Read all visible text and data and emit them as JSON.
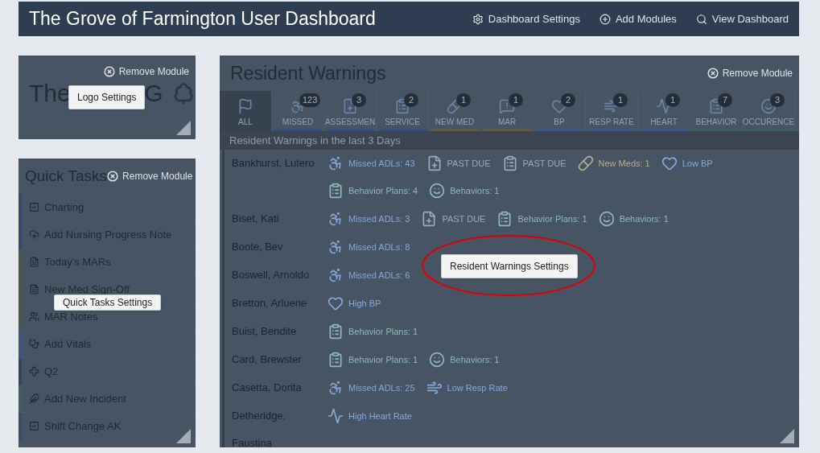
{
  "header": {
    "title": "The Grove of Farmington User Dashboard",
    "nav": [
      {
        "kind": "settings",
        "label": "Dashboard Settings"
      },
      {
        "kind": "add",
        "label": "Add Modules"
      },
      {
        "kind": "search",
        "label": "View Dashboard"
      }
    ]
  },
  "logo_module": {
    "remove": "Remove Module",
    "logo_text_left": "The",
    "logo_text_right": "G",
    "settings_button": "Logo Settings"
  },
  "quick_tasks": {
    "title": "Quick Tasks",
    "remove": "Remove Module",
    "settings_button": "Quick Tasks Settings",
    "items": [
      {
        "kind": "check",
        "label": "Charting",
        "color": "#34496a"
      },
      {
        "kind": "upload",
        "label": "Add Nursing Progress Note",
        "color": "#34496a"
      },
      {
        "kind": "rx",
        "label": "Today's MARs",
        "color": "#4b5550"
      },
      {
        "kind": "rx",
        "label": "New Med Sign-Off",
        "color": "#4b5550"
      },
      {
        "kind": "notes",
        "label": "MAR Notes",
        "color": "#4b5550"
      },
      {
        "kind": "vitals",
        "label": "Add Vitals",
        "color": "#3b5678"
      },
      {
        "kind": "cross",
        "label": "Q2",
        "color": "#36455e"
      },
      {
        "kind": "incident",
        "label": "Add New Incident",
        "color": "#3e5f5e"
      },
      {
        "kind": "check",
        "label": "Shift Change AK",
        "color": "#41476b"
      }
    ]
  },
  "resident_warnings": {
    "title": "Resident Warnings",
    "remove": "Remove Module",
    "settings_button": "Resident Warnings Settings",
    "section_title": "Resident Warnings in the last 3 Days",
    "tabs": [
      {
        "kind": "all",
        "label": "ALL",
        "selected": true
      },
      {
        "kind": "missed",
        "label": "MISSED",
        "badge": "123",
        "selected": false,
        "color": "#3b4f7a"
      },
      {
        "kind": "assessment",
        "label": "ASSESSMEN",
        "badge": "3",
        "selected": false,
        "color": "#3b4f7a"
      },
      {
        "kind": "service",
        "label": "SERVICE",
        "badge": "2",
        "selected": false,
        "color": "#3b4f7a"
      },
      {
        "kind": "meds",
        "label": "NEW MED",
        "badge": "1",
        "selected": false,
        "color": "#5c5a48"
      },
      {
        "kind": "mar",
        "label": "MAR",
        "badge": "1",
        "selected": false,
        "color": "#5c5a48"
      },
      {
        "kind": "bp",
        "label": "BP",
        "badge": "2",
        "selected": false,
        "color": "#3a5a82"
      },
      {
        "kind": "resp",
        "label": "RESP RATE",
        "badge": "1",
        "selected": false,
        "color": "#3a5a82"
      },
      {
        "kind": "heart",
        "label": "HEART",
        "badge": "1",
        "selected": false,
        "color": "#3a5a82"
      },
      {
        "kind": "behavior",
        "label": "BEHAVIOR",
        "badge": "7",
        "selected": false,
        "color": "#3d5e5a"
      },
      {
        "kind": "occurence",
        "label": "OCCURENCE",
        "badge": "3",
        "selected": false,
        "color": "#3d5e5a"
      }
    ],
    "residents": [
      {
        "name": "Bankhurst, Lutero",
        "warnings": [
          {
            "kind": "missed",
            "text": "Missed ADLs: 43"
          },
          {
            "kind": "assessment",
            "text": "PAST DUE"
          },
          {
            "kind": "service",
            "text": "PAST DUE"
          },
          {
            "kind": "meds",
            "text": "New Meds: 1"
          },
          {
            "kind": "bp",
            "text": "Low BP"
          },
          {
            "kind": "behavior",
            "text": "Behavior Plans: 4"
          },
          {
            "kind": "occurence",
            "text": "Behaviors: 1"
          }
        ]
      },
      {
        "name": "Biset, Kati",
        "warnings": [
          {
            "kind": "missed",
            "text": "Missed ADLs: 3"
          },
          {
            "kind": "assessment",
            "text": "PAST DUE"
          },
          {
            "kind": "behavior",
            "text": "Behavior Plans: 1"
          },
          {
            "kind": "occurence",
            "text": "Behaviors: 1"
          }
        ]
      },
      {
        "name": "Boote, Bev",
        "warnings": [
          {
            "kind": "missed",
            "text": "Missed ADLs: 8"
          }
        ]
      },
      {
        "name": "Boswell, Arnoldo",
        "warnings": [
          {
            "kind": "missed",
            "text": "Missed ADLs: 6"
          }
        ]
      },
      {
        "name": "Bretton, Arluene",
        "warnings": [
          {
            "kind": "bp",
            "text": "High BP"
          }
        ]
      },
      {
        "name": "Buist, Bendite",
        "warnings": [
          {
            "kind": "behavior",
            "text": "Behavior Plans: 1"
          }
        ]
      },
      {
        "name": "Card, Brewster",
        "warnings": [
          {
            "kind": "behavior",
            "text": "Behavior Plans: 1"
          },
          {
            "kind": "occurence",
            "text": "Behaviors: 1"
          }
        ]
      },
      {
        "name": "Casetta, Dorita",
        "warnings": [
          {
            "kind": "missed",
            "text": "Missed ADLs: 25"
          },
          {
            "kind": "resp",
            "text": "Low Resp Rate"
          }
        ]
      },
      {
        "name": "Detheridge, Faustina",
        "warnings": [
          {
            "kind": "heart",
            "text": "High Heart Rate"
          }
        ]
      }
    ]
  }
}
